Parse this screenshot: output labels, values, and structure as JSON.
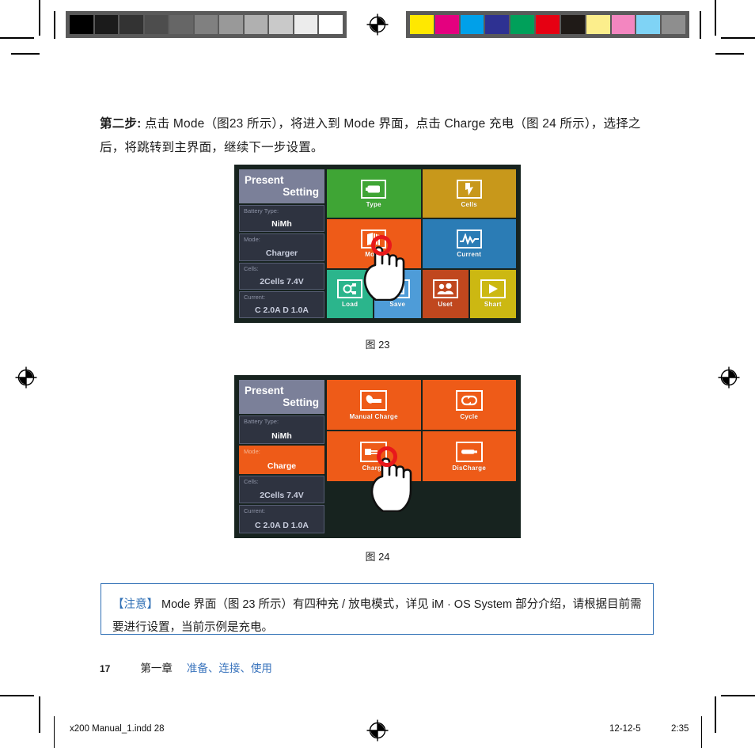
{
  "page": {
    "intro_label": "第二步:",
    "intro_text": " 点击 Mode（图23 所示），将进入到 Mode 界面，点击 Charge 充电（图 24 所示），选择之后，将跳转到主界面，继续下一步设置。",
    "figure23_caption": "图 23",
    "figure24_caption": "图 24"
  },
  "calibration": {
    "gray_bar": [
      "#000000",
      "#1b1b1b",
      "#333333",
      "#4d4d4d",
      "#666666",
      "#808080",
      "#999999",
      "#b0b0b0",
      "#c9c9c9",
      "#ececec",
      "#ffffff"
    ],
    "color_bar": [
      "#ffe800",
      "#e4007f",
      "#00a0e9",
      "#2e3192",
      "#00a05a",
      "#e60012",
      "#1f1a17",
      "#fcee8c",
      "#f386c0",
      "#7fd3f5",
      "#8e8e8e"
    ],
    "frame_color": "#5a5a5a"
  },
  "figure23": {
    "sidebar": {
      "title_line1": "Present",
      "title_line2": "Setting",
      "rows": [
        {
          "key": "Battery Type:",
          "value": "NiMh",
          "highlight": false,
          "bold": true
        },
        {
          "key": "Mode:",
          "value": "Charger",
          "highlight": false,
          "bold": false
        },
        {
          "key": "Cells:",
          "value": "2Cells  7.4V",
          "highlight": false,
          "bold": false
        },
        {
          "key": "Current:",
          "value": "C 2.0A  D 1.0A",
          "highlight": false,
          "bold": false
        }
      ]
    },
    "tiles": [
      [
        {
          "label": "Type",
          "icon": "battery-icon",
          "color": "#3fa535"
        },
        {
          "label": "Cells",
          "icon": "bolt-icon",
          "color": "#c8981b"
        }
      ],
      [
        {
          "label": "Mode",
          "icon": "stack-icon",
          "color": "#ee5b18"
        },
        {
          "label": "Current",
          "icon": "waveform-icon",
          "color": "#2b7cb5"
        }
      ],
      [
        {
          "label": "Load",
          "icon": "network-icon",
          "color": "#2bb58c"
        },
        {
          "label": "Save",
          "icon": "floppy-icon",
          "color": "#4e9cd8"
        },
        {
          "label": "Uset",
          "icon": "users-icon",
          "color": "#c0471e"
        },
        {
          "label": "Shart",
          "icon": "play-icon",
          "color": "#ccb812"
        }
      ]
    ],
    "tap_target": "Mode"
  },
  "figure24": {
    "sidebar": {
      "title_line1": "Present",
      "title_line2": "Setting",
      "rows": [
        {
          "key": "Battery Type:",
          "value": "NiMh",
          "highlight": false,
          "bold": true
        },
        {
          "key": "Mode:",
          "value": "Charge",
          "highlight": true,
          "bold": true
        },
        {
          "key": "Cells:",
          "value": "2Cells  7.4V",
          "highlight": false,
          "bold": false
        },
        {
          "key": "Current:",
          "value": "C 2.0A  D 1.0A",
          "highlight": false,
          "bold": false
        }
      ]
    },
    "tiles": [
      [
        {
          "label": "Manual  Charge",
          "icon": "manual-plug-icon",
          "color": "#ee5b18"
        },
        {
          "label": "Cycle",
          "icon": "cycle-icon",
          "color": "#ee5b18"
        }
      ],
      [
        {
          "label": "Charge",
          "icon": "plug-in-icon",
          "color": "#ee5b18"
        },
        {
          "label": "DisCharge",
          "icon": "battery-out-icon",
          "color": "#ee5b18"
        }
      ]
    ],
    "tap_target": "Charge"
  },
  "note": {
    "bracket_open": "【",
    "attention": "注意",
    "bracket_close": "】",
    "text": " Mode 界面（图 23 所示）有四种充 / 放电模式，详见 iM · OS System 部分介绍，请根据目前需要进行设置，当前示例是充电。",
    "accent_color": "#2f6fb5"
  },
  "footer": {
    "page_number": "17",
    "chapter": "第一章",
    "chapter_title": "准备、连接、使用",
    "chapter_title_color": "#3a74bd"
  },
  "print_footer": {
    "file_name": "x200 Manual_1.indd   28",
    "date": "12-12-5",
    "time": "2:35"
  }
}
